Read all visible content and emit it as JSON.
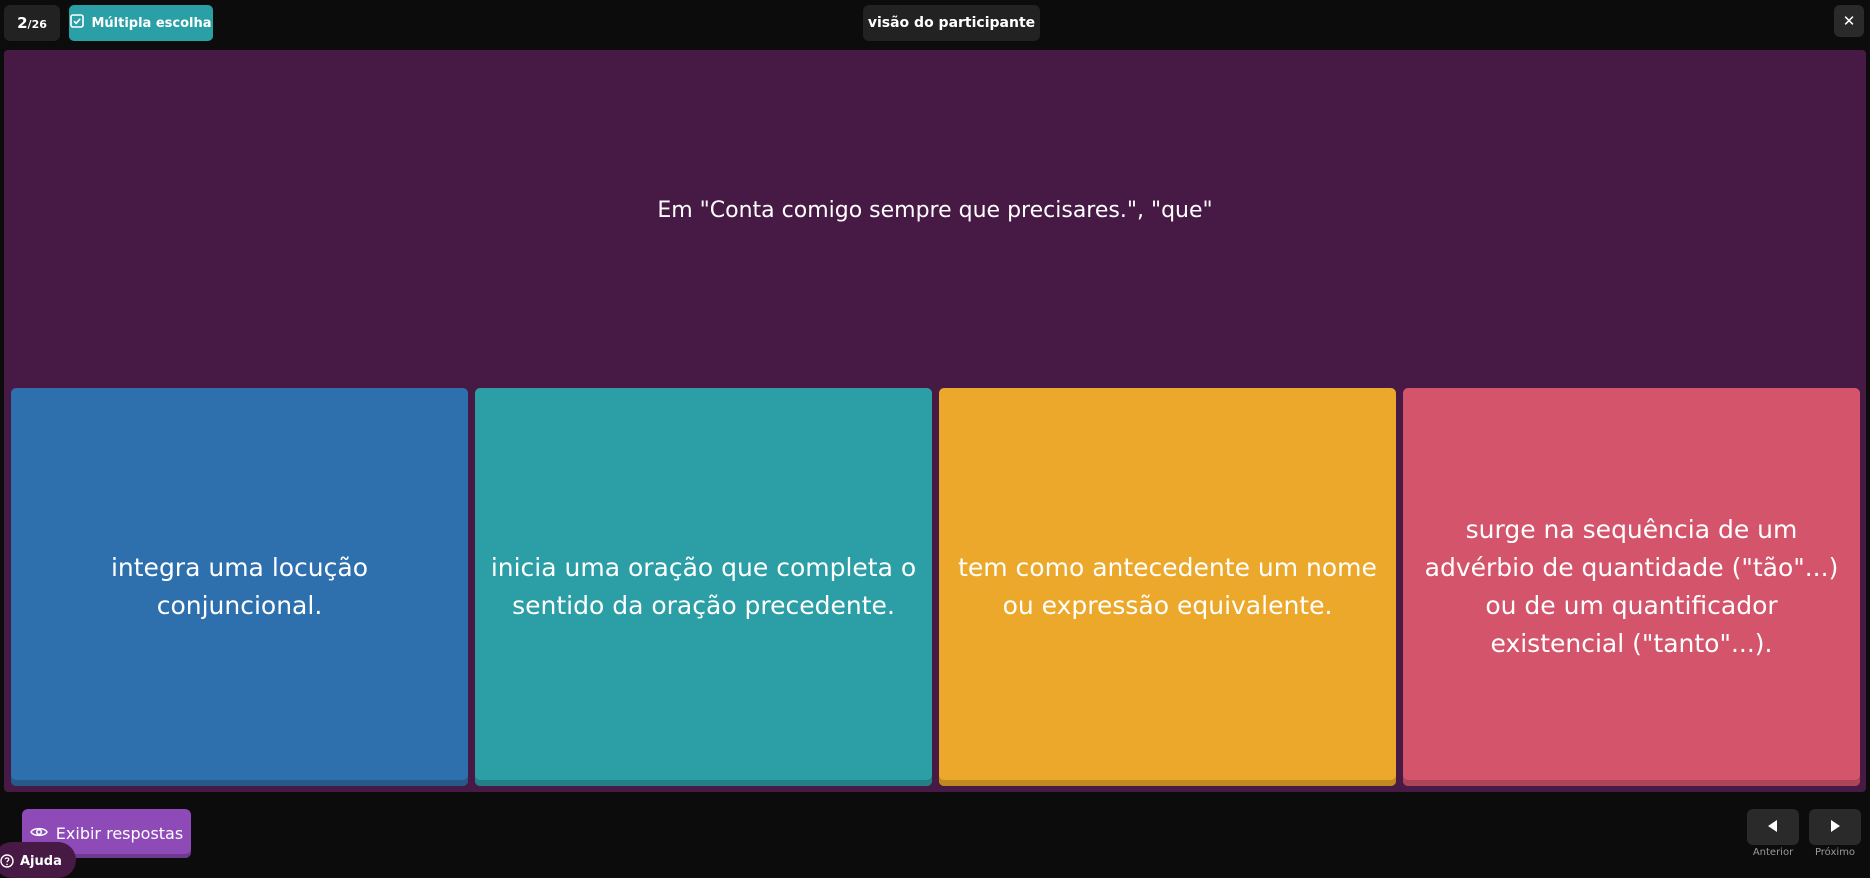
{
  "header": {
    "counter_current": "2",
    "counter_total": "/26",
    "question_type": "Múltipla escolha",
    "view_mode": "visão do participante",
    "close_symbol": "✕"
  },
  "question": {
    "text": "Em \"Conta comigo sempre que precisares.\", \"que\""
  },
  "answers": [
    {
      "text": "integra uma locução conjuncional.",
      "color": "#2e6fae"
    },
    {
      "text": "inicia uma oração que completa o sentido da oração precedente.",
      "color": "#2c9ea5"
    },
    {
      "text": "tem como antecedente um nome ou expressão equivalente.",
      "color": "#eca82a"
    },
    {
      "text": "surge na sequência de um advérbio de quantidade (\"tão\"...) ou de um quantificador existencial (\"tanto\"...).",
      "color": "#d4546c"
    }
  ],
  "footer": {
    "show_answers_label": "Exibir respostas",
    "help_label": "Ajuda",
    "prev_label": "Anterior",
    "next_label": "Próximo"
  },
  "colors": {
    "background": "#0c0c0c",
    "slide": "#461a44",
    "badge_accent": "#2a9fa6",
    "show_answers": "#8e4bb8"
  },
  "icons": {
    "type_badge": "checkbox-icon",
    "show_answers": "eye-icon",
    "help": "help-circle-icon",
    "prev": "triangle-left-icon",
    "next": "triangle-right-icon"
  }
}
